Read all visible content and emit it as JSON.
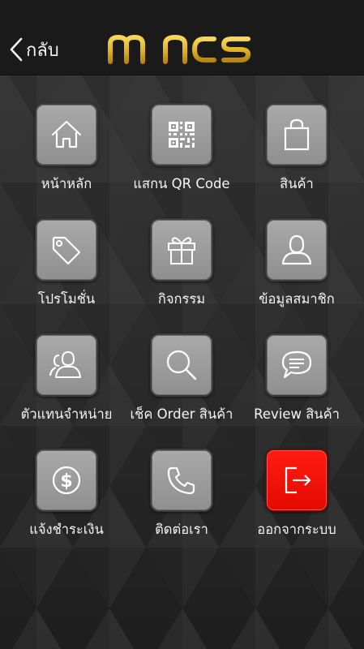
{
  "header": {
    "back_label": "กลับ",
    "logo_text": "mincs",
    "brand_color": "#e3b52a"
  },
  "menu": [
    {
      "label": "หน้าหลัก",
      "icon": "home-icon"
    },
    {
      "label": "แสกน QR Code",
      "icon": "qr-code-icon"
    },
    {
      "label": "สินค้า",
      "icon": "shopping-bag-icon"
    },
    {
      "label": "โปรโมชั่น",
      "icon": "tag-icon"
    },
    {
      "label": "กิจกรรม",
      "icon": "gift-icon"
    },
    {
      "label": "ข้อมูลสมาชิก",
      "icon": "user-icon"
    },
    {
      "label": "ตัวแทนจำหน่าย",
      "icon": "users-icon"
    },
    {
      "label": "เช็ค Order สินค้า",
      "icon": "search-icon"
    },
    {
      "label": "Review สินค้า",
      "icon": "chat-bubble-icon"
    },
    {
      "label": "แจ้งชำระเงิน",
      "icon": "dollar-coin-icon"
    },
    {
      "label": "ติดต่อเรา",
      "icon": "phone-icon"
    },
    {
      "label": "ออกจากระบบ",
      "icon": "logout-icon",
      "accent": "#f2120a"
    }
  ]
}
